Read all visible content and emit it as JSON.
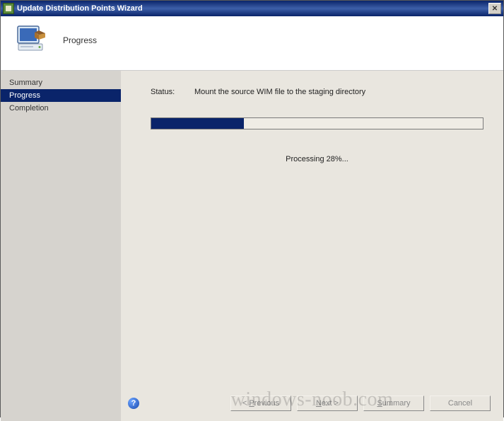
{
  "titlebar": {
    "title": "Update Distribution Points Wizard"
  },
  "header": {
    "page_title": "Progress"
  },
  "sidebar": {
    "items": [
      {
        "label": "Summary",
        "active": false
      },
      {
        "label": "Progress",
        "active": true
      },
      {
        "label": "Completion",
        "active": false
      }
    ]
  },
  "main": {
    "status_label": "Status:",
    "status_text": "Mount the source WIM file to the staging directory",
    "progress_percent": 28,
    "processing_text": "Processing 28%..."
  },
  "buttons": {
    "previous": "< Previous",
    "next": "Next >",
    "summary": "Summary",
    "cancel": "Cancel"
  },
  "watermark": "windows-noob.com"
}
